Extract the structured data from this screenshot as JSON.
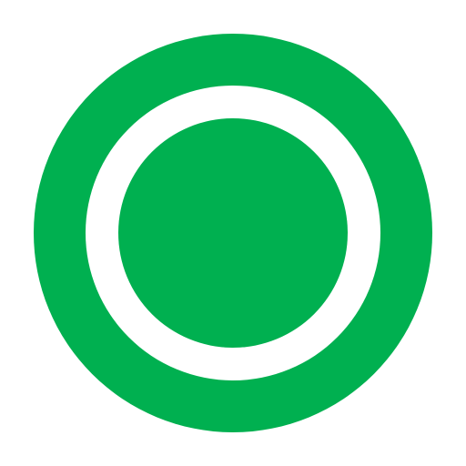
{
  "icon": {
    "name": "radio-button-selected-icon",
    "colors": {
      "primary": "#00B050",
      "background": "#FFFFFF"
    }
  }
}
